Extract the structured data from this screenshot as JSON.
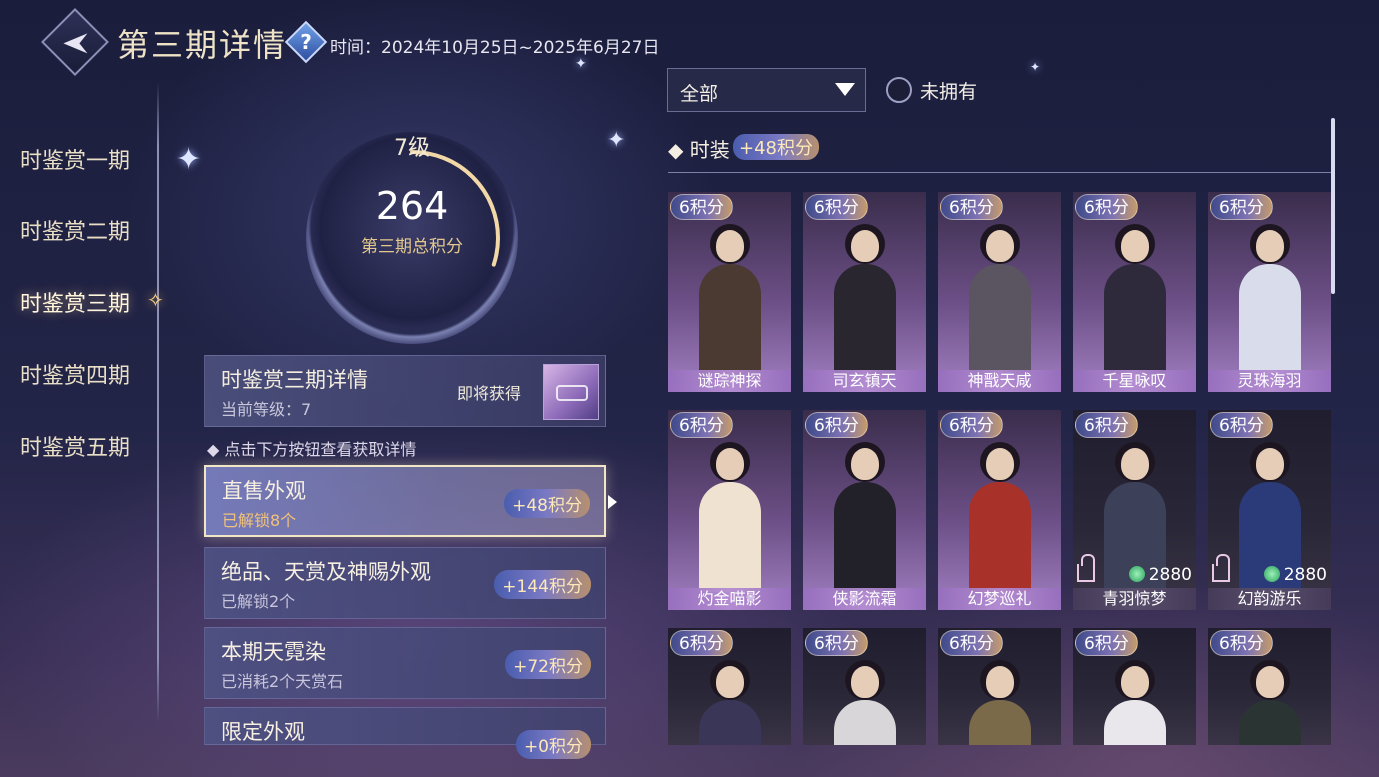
{
  "header": {
    "title": "第三期详情",
    "help": "?",
    "period": "时间：2024年10月25日~2025年6月27日"
  },
  "nav": {
    "items": [
      {
        "label": "时鉴赏一期"
      },
      {
        "label": "时鉴赏二期"
      },
      {
        "label": "时鉴赏三期",
        "active": true
      },
      {
        "label": "时鉴赏四期"
      },
      {
        "label": "时鉴赏五期"
      }
    ]
  },
  "score": {
    "level": "7级",
    "total": "264",
    "label": "第三期总积分",
    "level_progress": 0.3
  },
  "detail": {
    "title": "时鉴赏三期详情",
    "current_level": "当前等级：7",
    "soon_label": "即将获得"
  },
  "hint": "点击下方按钮查看获取详情",
  "sources": [
    {
      "title": "直售外观",
      "sub": "已解锁8个",
      "badge": "+48积分",
      "active": true
    },
    {
      "title": "绝品、天赏及神赐外观",
      "sub": "已解锁2个",
      "badge": "+144积分"
    },
    {
      "title": "本期天霓染",
      "sub": "已消耗2个天赏石",
      "badge": "+72积分"
    },
    {
      "title": "限定外观",
      "sub": "",
      "badge": "+0积分"
    }
  ],
  "filter": {
    "selected": "全部",
    "unowned_label": "未拥有"
  },
  "section": {
    "title": "时装",
    "badge": "+48积分"
  },
  "cards": [
    {
      "points": "6积分",
      "name": "谜踪神探",
      "owned": true,
      "color": "#4a3a32"
    },
    {
      "points": "6积分",
      "name": "司玄镇天",
      "owned": true,
      "color": "#2a2630"
    },
    {
      "points": "6积分",
      "name": "神戬天咸",
      "owned": true,
      "color": "#5a5560"
    },
    {
      "points": "6积分",
      "name": "千星咏叹",
      "owned": true,
      "color": "#2e2a3c"
    },
    {
      "points": "6积分",
      "name": "灵珠海羽",
      "owned": true,
      "color": "#d9dceb"
    },
    {
      "points": "6积分",
      "name": "灼金喵影",
      "owned": true,
      "color": "#efe2d0"
    },
    {
      "points": "6积分",
      "name": "侠影流霜",
      "owned": true,
      "color": "#222028"
    },
    {
      "points": "6积分",
      "name": "幻梦巡礼",
      "owned": true,
      "color": "#a8322a"
    },
    {
      "points": "6积分",
      "name": "青羽惊梦",
      "owned": false,
      "price": "2880",
      "color": "#3c4058"
    },
    {
      "points": "6积分",
      "name": "幻韵游乐",
      "owned": false,
      "price": "2880",
      "color": "#2b3a78"
    },
    {
      "points": "6积分",
      "name": "",
      "owned": false,
      "color": "#3a3658"
    },
    {
      "points": "6积分",
      "name": "",
      "owned": false,
      "color": "#d8d6d8"
    },
    {
      "points": "6积分",
      "name": "",
      "owned": false,
      "color": "#7a6a4a"
    },
    {
      "points": "6积分",
      "name": "",
      "owned": false,
      "color": "#e9e6ec"
    },
    {
      "points": "6积分",
      "name": "",
      "owned": false,
      "color": "#2a3432"
    }
  ]
}
